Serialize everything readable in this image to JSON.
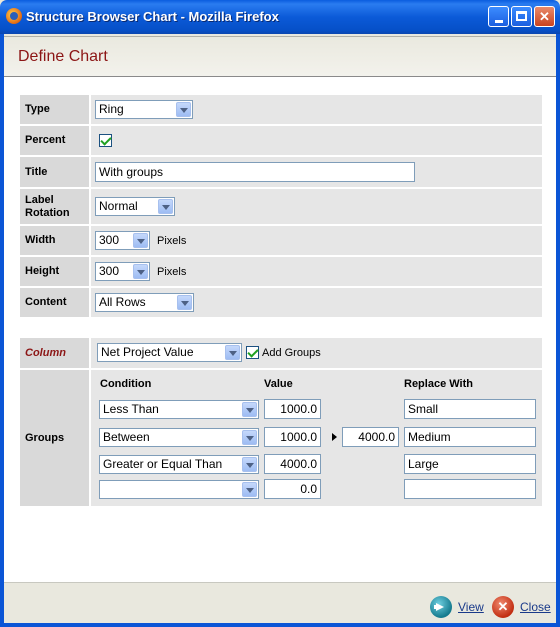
{
  "window": {
    "title": "Structure Browser Chart - Mozilla Firefox"
  },
  "page": {
    "title": "Define Chart"
  },
  "form": {
    "type": {
      "label": "Type",
      "value": "Ring"
    },
    "percent": {
      "label": "Percent",
      "checked": true
    },
    "title": {
      "label": "Title",
      "value": "With groups"
    },
    "label_rotation": {
      "label": "Label Rotation",
      "value": "Normal"
    },
    "width": {
      "label": "Width",
      "value": "300",
      "unit": "Pixels"
    },
    "height": {
      "label": "Height",
      "value": "300",
      "unit": "Pixels"
    },
    "content": {
      "label": "Content",
      "value": "All Rows"
    }
  },
  "column": {
    "label": "Column",
    "value": "Net Project Value",
    "add_groups_checked": true,
    "add_groups_label": "Add Groups"
  },
  "groups": {
    "label": "Groups",
    "headers": {
      "condition": "Condition",
      "value": "Value",
      "replace_with": "Replace With"
    },
    "rows": [
      {
        "condition": "Less Than",
        "value": "1000.0",
        "value2": "",
        "replace": "Small"
      },
      {
        "condition": "Between",
        "value": "1000.0",
        "value2": "4000.0",
        "replace": "Medium"
      },
      {
        "condition": "Greater or Equal Than",
        "value": "4000.0",
        "value2": "",
        "replace": "Large"
      },
      {
        "condition": "",
        "value": "0.0",
        "value2": "",
        "replace": ""
      }
    ]
  },
  "footer": {
    "view_label": "View",
    "close_label": "Close"
  }
}
